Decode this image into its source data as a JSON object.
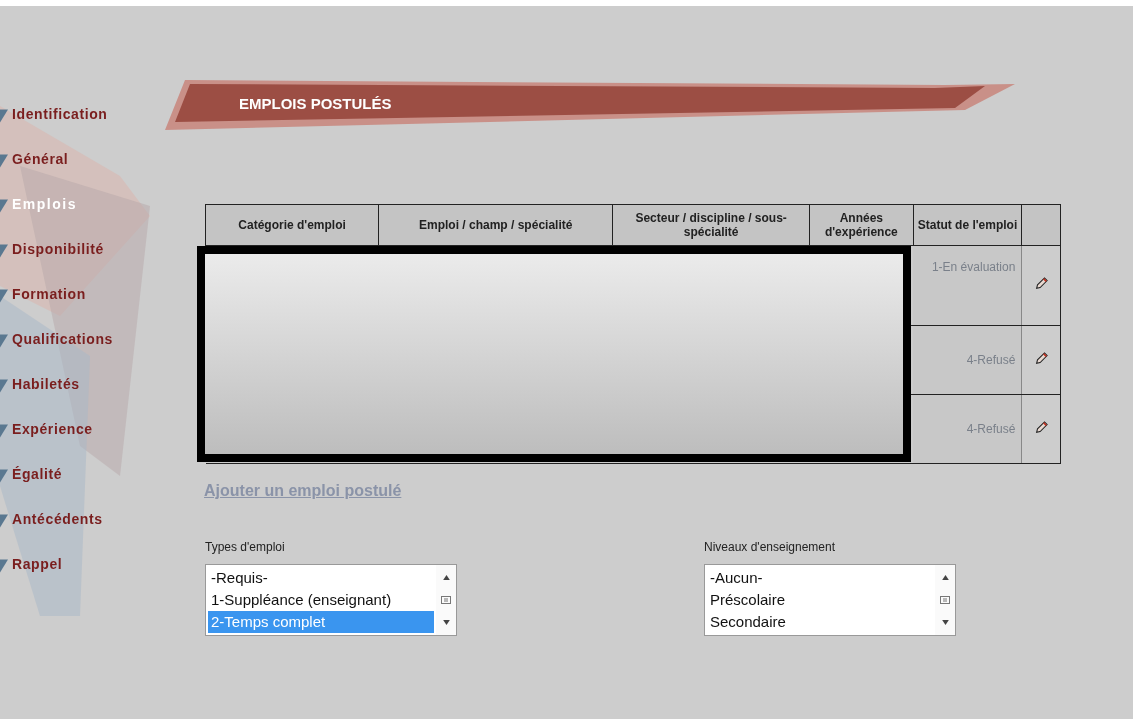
{
  "sidebar": {
    "items": [
      {
        "label": "Identification",
        "selected": false
      },
      {
        "label": "Général",
        "selected": false
      },
      {
        "label": "Emplois",
        "selected": true
      },
      {
        "label": "Disponibilité",
        "selected": false
      },
      {
        "label": "Formation",
        "selected": false
      },
      {
        "label": "Qualifications",
        "selected": false
      },
      {
        "label": "Habiletés",
        "selected": false
      },
      {
        "label": "Expérience",
        "selected": false
      },
      {
        "label": "Égalité",
        "selected": false
      },
      {
        "label": "Antécédents",
        "selected": false
      },
      {
        "label": "Rappel",
        "selected": false
      }
    ]
  },
  "section": {
    "title": "EMPLOIS POSTULÉS"
  },
  "table": {
    "columns": [
      "Catégorie d'emploi",
      "Emploi / champ / spécialité",
      "Secteur / discipline / sous-spécialité",
      "Années d'expérience",
      "Statut de l'emploi"
    ],
    "rows": [
      {
        "status": "1-En évaluation"
      },
      {
        "status": "4-Refusé"
      },
      {
        "status": "4-Refusé"
      }
    ]
  },
  "add_link": "Ajouter un emploi postulé",
  "lists": [
    {
      "label": "Types d'emploi",
      "options": [
        {
          "text": "-Requis-",
          "selected": false
        },
        {
          "text": "1-Suppléance (enseignant)",
          "selected": false
        },
        {
          "text": "2-Temps complet",
          "selected": true
        }
      ]
    },
    {
      "label": "Niveaux d'enseignement",
      "options": [
        {
          "text": "-Aucun-",
          "selected": false
        },
        {
          "text": "Préscolaire",
          "selected": false
        },
        {
          "text": "Secondaire",
          "selected": false
        }
      ]
    }
  ]
}
